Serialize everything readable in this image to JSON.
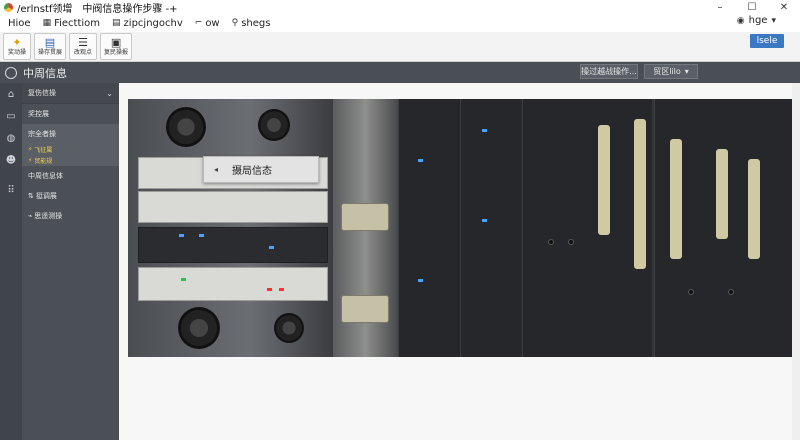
{
  "window": {
    "title": "/erlnstf领增　中阀信息操作步骤 -+",
    "controls": [
      "–",
      "☐",
      "✕"
    ]
  },
  "menubar": {
    "items": [
      {
        "label": "Hioe",
        "icon": ""
      },
      {
        "label": "Fiecttiom",
        "icon": "grid-icon"
      },
      {
        "label": "zipcjngochv",
        "icon": "table-icon"
      },
      {
        "label": "ow",
        "icon": "chevron-icon"
      },
      {
        "label": "shegs",
        "icon": "pin-icon"
      }
    ],
    "user": "hge"
  },
  "toolbar": {
    "buttons": [
      {
        "label": "奖动操",
        "icon": "✦"
      },
      {
        "label": "操存贯展",
        "icon": "▤"
      },
      {
        "label": "改观点",
        "icon": "☰"
      },
      {
        "label": "复民操报",
        "icon": "▣"
      }
    ],
    "primary_label": "lsele"
  },
  "header": {
    "title": "中周信息",
    "button1": "操过越战操作...",
    "button2": "贸区lilo"
  },
  "sidebar": {
    "head_label": "复伤信操",
    "items": [
      {
        "label": "奖控展"
      },
      {
        "label": "宗全者操",
        "sub": [
          "飞征属",
          "贸能规"
        ]
      },
      {
        "label": "中周信息体"
      },
      {
        "label": "挺调展"
      },
      {
        "label": "思遥测操"
      }
    ]
  },
  "content": {
    "tooltip_text": "摄局信态"
  },
  "colors": {
    "accent": "#3b78c3",
    "header_bg": "#4a4e55",
    "sidebar_bg": "#4b4f56"
  }
}
